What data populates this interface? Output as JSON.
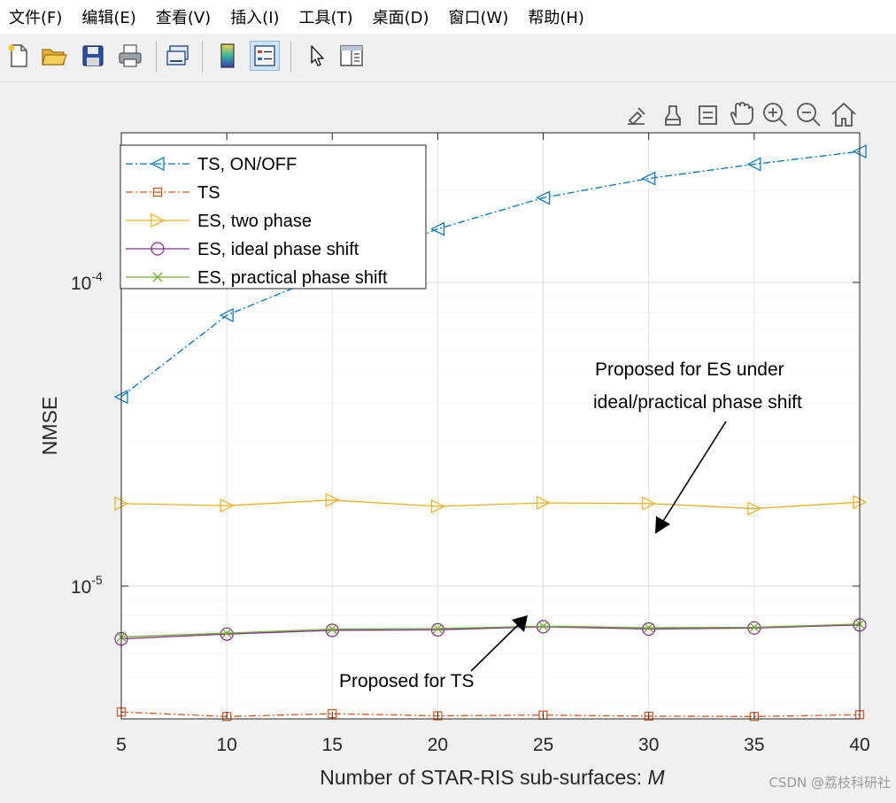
{
  "menu": [
    "文件(F)",
    "编辑(E)",
    "查看(V)",
    "插入(I)",
    "工具(T)",
    "桌面(D)",
    "窗口(W)",
    "帮助(H)"
  ],
  "toolbar": [
    "new-file-icon",
    "open-folder-icon",
    "save-icon",
    "print-icon",
    "link-plot-icon",
    "colorbar-icon",
    "legend-icon",
    "pointer-icon",
    "property-editor-icon"
  ],
  "axes_toolbar": [
    "brush-export-icon",
    "data-brush-icon",
    "datatip-icon",
    "pan-icon",
    "zoom-in-icon",
    "zoom-out-icon",
    "home-icon"
  ],
  "chart_data": {
    "type": "line",
    "xlabel": "Number of STAR-RIS sub-surfaces: ",
    "xlabel_italic": "M",
    "ylabel": "NMSE",
    "yscale": "log",
    "ylim": [
      3.7e-06,
      0.000215
    ],
    "xlim": [
      5,
      40
    ],
    "x": [
      5,
      10,
      15,
      20,
      25,
      30,
      35,
      40
    ],
    "xticks": [
      "5",
      "10",
      "15",
      "20",
      "25",
      "30",
      "35",
      "40"
    ],
    "yticks": [
      {
        "base": "10",
        "exp": "-5",
        "value": 1e-05
      },
      {
        "base": "10",
        "exp": "-4",
        "value": 0.0001
      }
    ],
    "grid": true,
    "legend_position": "top-left",
    "series": [
      {
        "name": "TS, ON/OFF",
        "color": "#0072BD",
        "marker": "triangle-left",
        "dash": "8,3,2,3",
        "values": [
          4.2e-05,
          7.8e-05,
          0.000108,
          0.00015,
          0.00019,
          0.00022,
          0.000245,
          0.00027
        ]
      },
      {
        "name": "TS",
        "color": "#D95319",
        "marker": "square",
        "dash": "8,3,2,3",
        "values": [
          3.85e-06,
          3.72e-06,
          3.8e-06,
          3.74e-06,
          3.76e-06,
          3.73e-06,
          3.72e-06,
          3.77e-06
        ]
      },
      {
        "name": "ES, two phase",
        "color": "#EDB120",
        "marker": "triangle-right",
        "dash": "",
        "values": [
          1.87e-05,
          1.84e-05,
          1.92e-05,
          1.83e-05,
          1.88e-05,
          1.87e-05,
          1.8e-05,
          1.89e-05
        ]
      },
      {
        "name": "ES, ideal phase shift",
        "color": "#7E2F8E",
        "marker": "circle",
        "dash": "",
        "values": [
          6.7e-06,
          6.95e-06,
          7.15e-06,
          7.18e-06,
          7.35e-06,
          7.22e-06,
          7.28e-06,
          7.45e-06
        ]
      },
      {
        "name": "ES, practical phase shift",
        "color": "#77AC30",
        "marker": "x",
        "dash": "",
        "values": [
          6.8e-06,
          7e-06,
          7.22e-06,
          7.25e-06,
          7.38e-06,
          7.3e-06,
          7.32e-06,
          7.5e-06
        ]
      }
    ],
    "annotations": {
      "es_line1": "Proposed for ES under",
      "es_line2": "ideal/practical phase shift",
      "ts": "Proposed for TS"
    }
  },
  "watermark": "CSDN @荔枝科研社"
}
